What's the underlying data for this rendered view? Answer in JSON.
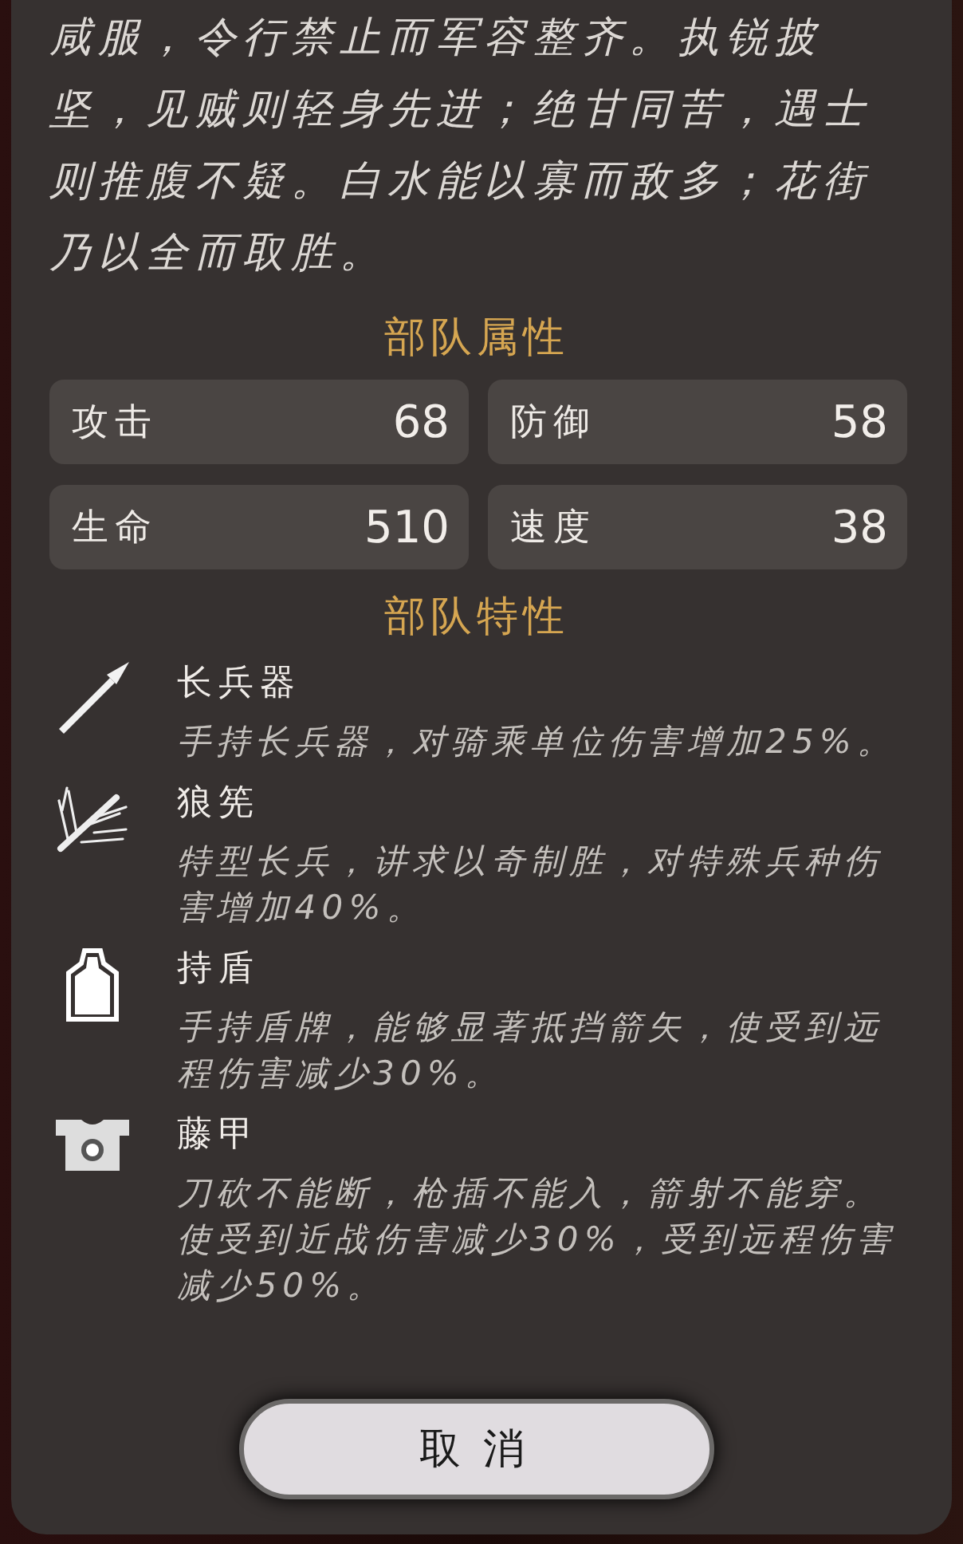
{
  "intro": "咸服，令行禁止而军容整齐。执锐披坚，见贼则轻身先进；绝甘同苦，遇士则推腹不疑。白水能以寡而敌多；花街乃以全而取胜。",
  "attributes": {
    "title": "部队属性",
    "stats": [
      {
        "label": "攻击",
        "value": "68"
      },
      {
        "label": "防御",
        "value": "58"
      },
      {
        "label": "生命",
        "value": "510"
      },
      {
        "label": "速度",
        "value": "38"
      }
    ]
  },
  "traits": {
    "title": "部队特性",
    "items": [
      {
        "kind": "spear",
        "name": "长兵器",
        "description": "手持长兵器，对骑乘单位伤害增加25%。"
      },
      {
        "kind": "branch",
        "name": "狼筅",
        "description": "特型长兵，讲求以奇制胜，对特殊兵种伤害增加40%。"
      },
      {
        "kind": "shield",
        "name": "持盾",
        "description": "手持盾牌，能够显著抵挡箭矢，使受到远程伤害减少30%。"
      },
      {
        "kind": "armor",
        "name": "藤甲",
        "description": "刀砍不能断，枪插不能入，箭射不能穿。使受到近战伤害减少30%，受到远程伤害减少50%。"
      }
    ]
  },
  "button": {
    "label": "取消"
  }
}
